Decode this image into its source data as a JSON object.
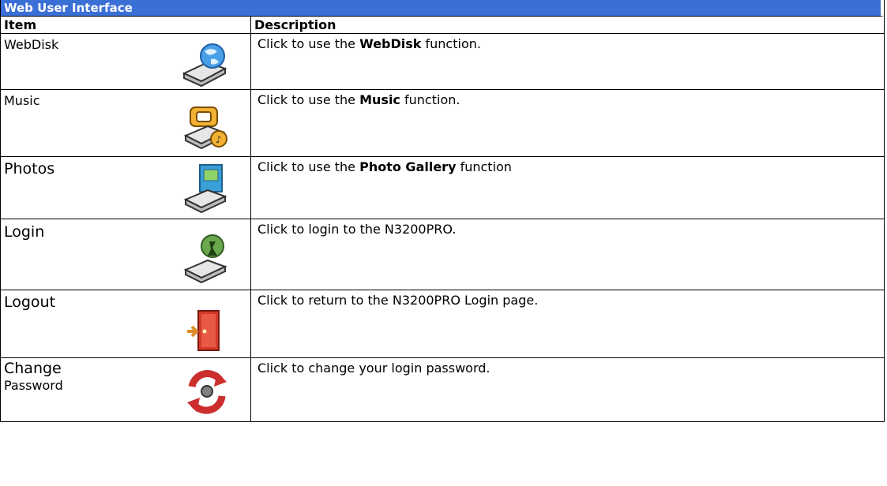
{
  "title": "Web User Interface",
  "header": {
    "item": "Item",
    "description": "Description"
  },
  "rows": [
    {
      "item": "WebDisk",
      "desc_pre": "Click to use the ",
      "desc_bold": "WebDisk",
      "desc_post": " function.",
      "icon": "webdisk-icon"
    },
    {
      "item": "Music",
      "desc_pre": "Click to use the ",
      "desc_bold": "Music",
      "desc_post": " function.",
      "icon": "music-icon"
    },
    {
      "item": "Photos",
      "desc_pre": "Click to use the ",
      "desc_bold": "Photo Gallery",
      "desc_post": " function",
      "icon": "photos-icon"
    },
    {
      "item": "Login",
      "desc_pre": "Click to login to the N3200PRO.",
      "desc_bold": "",
      "desc_post": "",
      "icon": "login-icon"
    },
    {
      "item": "Logout",
      "desc_pre": "Click to return to the N3200PRO Login page.",
      "desc_bold": "",
      "desc_post": "",
      "icon": "logout-icon"
    },
    {
      "item_line1": "Change",
      "item_line2": "Password",
      "desc_pre": "Click to change your login password.",
      "desc_bold": "",
      "desc_post": "",
      "icon": "change-password-icon"
    }
  ],
  "colors": {
    "title_bg": "#3a6fd6",
    "title_text": "#ffffff"
  }
}
